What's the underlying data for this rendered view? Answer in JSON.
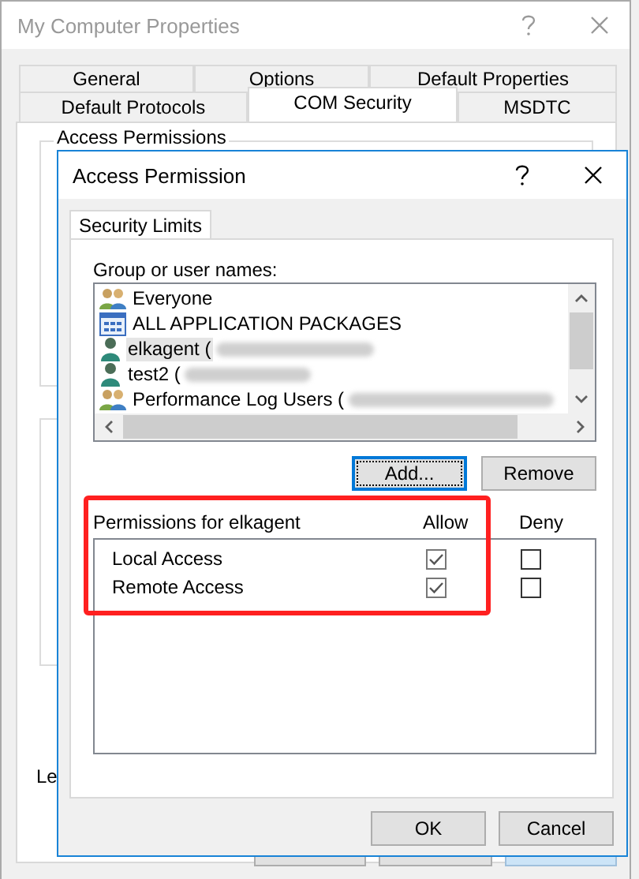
{
  "window": {
    "title": "My Computer Properties",
    "active": false
  },
  "tabs": [
    [
      {
        "label": "General",
        "selected": false
      },
      {
        "label": "Options",
        "selected": false
      },
      {
        "label": "Default Properties",
        "selected": false
      }
    ],
    [
      {
        "label": "Default Protocols",
        "selected": false
      },
      {
        "label": "COM Security",
        "selected": true
      },
      {
        "label": "MSDTC",
        "selected": false
      }
    ]
  ],
  "group_label": "Access Permissions",
  "partial_label": "Le",
  "dialog": {
    "title": "Access Permission",
    "active": true,
    "tabs": [
      {
        "label": "Security Limits",
        "selected": true
      }
    ],
    "users_label": "Group or user names:",
    "users": [
      {
        "kind": "group",
        "name": "Everyone",
        "redacted": false,
        "selected": false
      },
      {
        "kind": "packages",
        "name": "ALL APPLICATION PACKAGES",
        "redacted": false,
        "selected": false
      },
      {
        "kind": "user",
        "name": "elkagent (",
        "redacted": true,
        "selected": true
      },
      {
        "kind": "user",
        "name": "test2 (",
        "redacted": true,
        "selected": false
      },
      {
        "kind": "group",
        "name": "Performance Log Users (",
        "redacted": true,
        "selected": false
      }
    ],
    "list_buttons": [
      {
        "label": "Add...",
        "focused": true
      },
      {
        "label": "Remove",
        "focused": false
      }
    ],
    "permissions": {
      "title": "Permissions for elkagent",
      "columns": [
        "Allow",
        "Deny"
      ],
      "highlighted": true,
      "rows": [
        {
          "name": "Local Access",
          "allow": true,
          "deny": false
        },
        {
          "name": "Remote Access",
          "allow": true,
          "deny": false
        }
      ]
    },
    "buttons": [
      "OK",
      "Cancel"
    ]
  }
}
